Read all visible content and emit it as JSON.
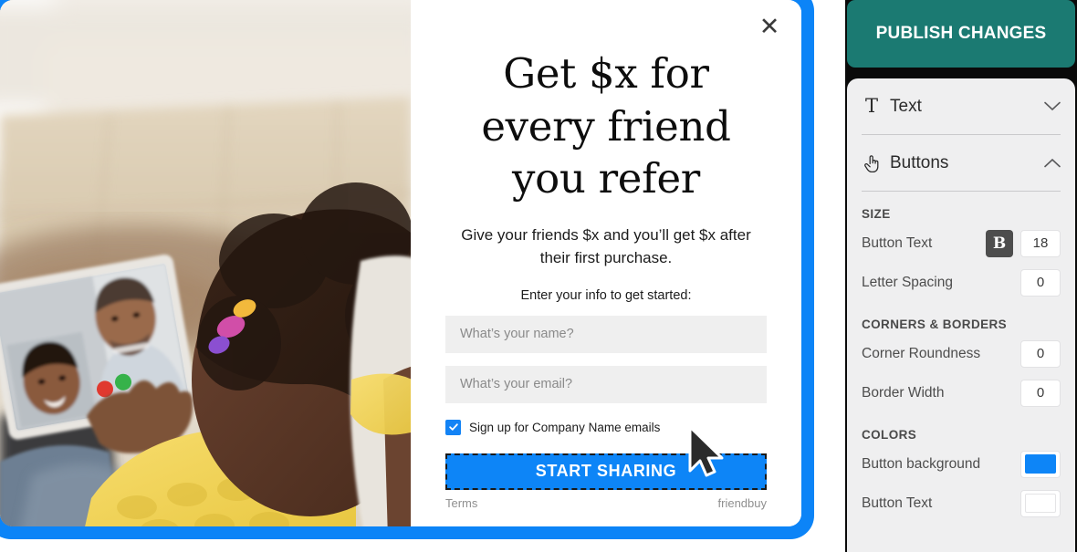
{
  "popup": {
    "close_icon": "close-icon",
    "headline": "Get $x for every friend you refer",
    "subheadline": "Give your friends $x and you’ll get $x after their first purchase.",
    "prompt": "Enter your info to get started:",
    "name_placeholder": "What’s your name?",
    "name_value": "",
    "email_placeholder": "What’s your email?",
    "email_value": "",
    "optin_label": "Sign up for Company Name emails",
    "optin_checked": true,
    "cta_label": "START SHARING",
    "footer": {
      "terms": "Terms",
      "brand": "friendbuy"
    },
    "accent_color": "#0d85f7",
    "frame_color": "#0c84f7",
    "cursor_icon": "mouse-arrow-cursor"
  },
  "sidebar": {
    "publish_label": "PUBLISH CHANGES",
    "publish_color": "#1b7a72",
    "accordions": [
      {
        "label": "Text",
        "icon": "serif-t-icon",
        "glyph": "T",
        "state": "collapsed",
        "chevron": "chevron-down-icon"
      },
      {
        "label": "Buttons",
        "icon": "hand-pointer-icon",
        "state": "expanded",
        "chevron": "chevron-up-icon"
      }
    ],
    "sections": [
      {
        "title": "SIZE",
        "rows": [
          {
            "label": "Button Text",
            "bold_toggle": "B",
            "bold_active": true,
            "value": "18",
            "type": "number"
          },
          {
            "label": "Letter Spacing",
            "value": "0",
            "type": "number"
          }
        ]
      },
      {
        "title": "CORNERS & BORDERS",
        "rows": [
          {
            "label": "Corner Roundness",
            "value": "0",
            "type": "number"
          },
          {
            "label": "Border Width",
            "value": "0",
            "type": "number"
          }
        ]
      },
      {
        "title": "COLORS",
        "rows": [
          {
            "label": "Button background",
            "value": "#0d85f7",
            "type": "color"
          },
          {
            "label": "Button Text",
            "value": "#ffffff",
            "type": "color"
          }
        ]
      }
    ]
  }
}
